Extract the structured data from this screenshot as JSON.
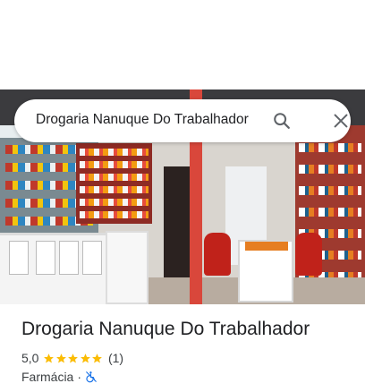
{
  "search": {
    "query": "Drogaria Nanuque Do Trabalhador",
    "search_icon": "search-icon",
    "close_icon": "close-icon"
  },
  "place": {
    "title": "Drogaria Nanuque Do Trabalhador",
    "rating": "5,0",
    "rating_fraction": 1.0,
    "stars_filled": 5,
    "review_count": "(1)",
    "category": "Farmácia",
    "separator": "·",
    "accessibility_icon": "no-wheelchair-access-icon"
  },
  "colors": {
    "star": "#FBBC04",
    "accessibility_icon": "#1A73E8",
    "text_primary": "#202124",
    "text_secondary": "#3C4043"
  }
}
